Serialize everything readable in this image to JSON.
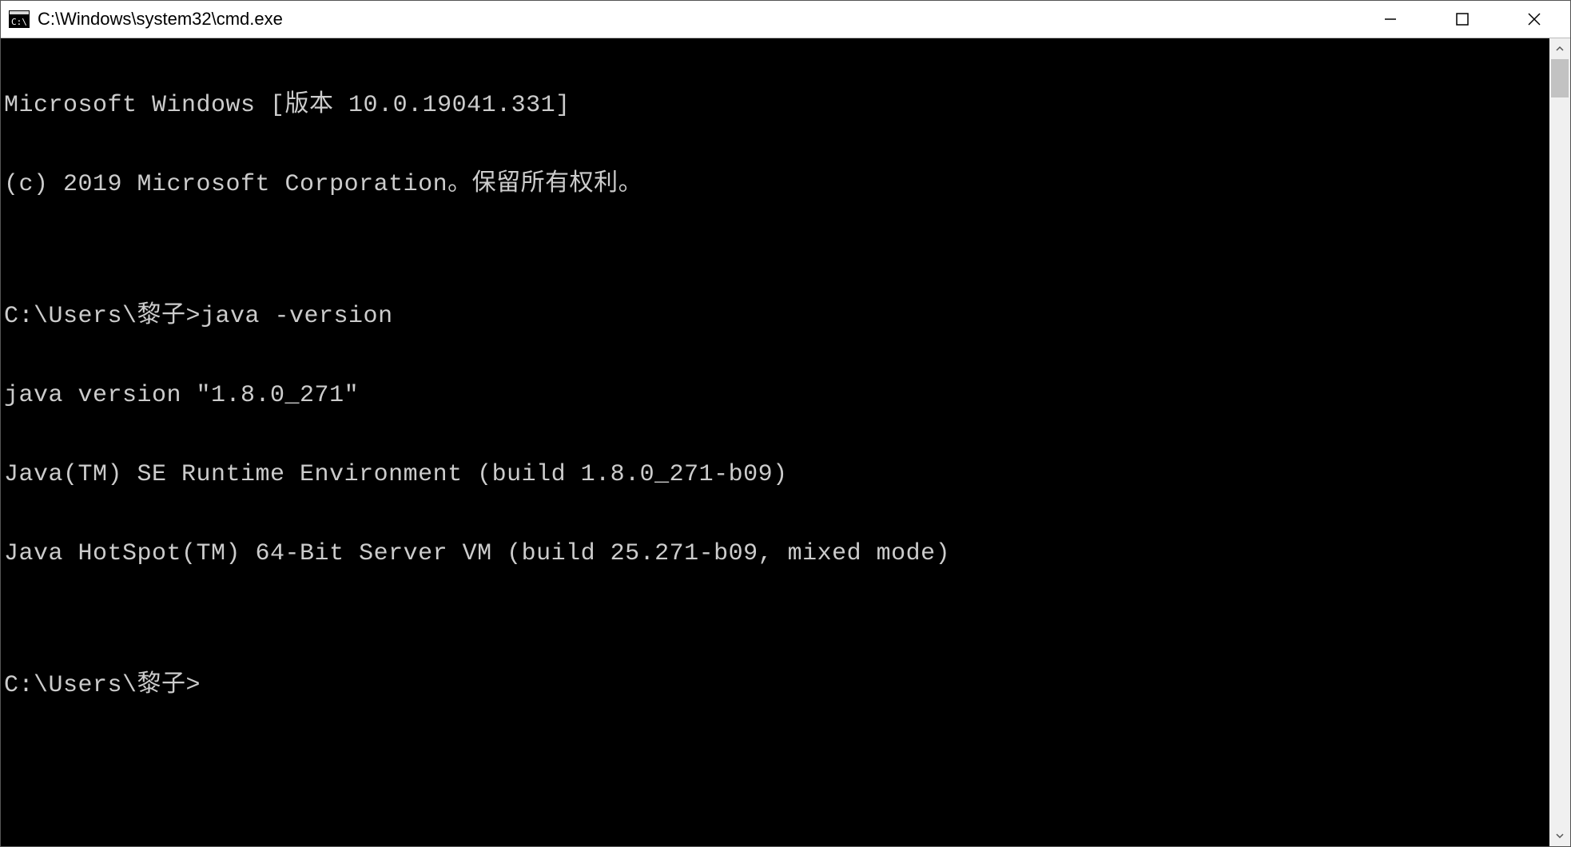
{
  "titlebar": {
    "title": "C:\\Windows\\system32\\cmd.exe",
    "minimize_tooltip": "Minimize",
    "maximize_tooltip": "Maximize",
    "close_tooltip": "Close"
  },
  "terminal": {
    "lines": [
      "Microsoft Windows [版本 10.0.19041.331]",
      "(c) 2019 Microsoft Corporation。保留所有权利。",
      "",
      "C:\\Users\\黎子>java -version",
      "java version \"1.8.0_271\"",
      "Java(TM) SE Runtime Environment (build 1.8.0_271-b09)",
      "Java HotSpot(TM) 64-Bit Server VM (build 25.271-b09, mixed mode)",
      "",
      "C:\\Users\\黎子>"
    ]
  }
}
